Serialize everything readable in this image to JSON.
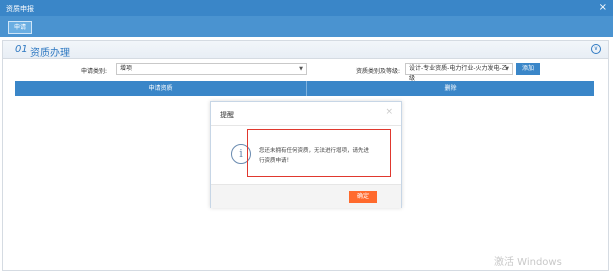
{
  "window": {
    "title": "资质申报",
    "close_glyph": "×"
  },
  "toolbar": {
    "apply_label": "申请"
  },
  "section": {
    "number": "01",
    "title": "资质办理",
    "collapse_icon": "chevron-down-icon"
  },
  "form": {
    "apply_type_label": "申请类别:",
    "apply_type_value": "增项",
    "qualification_label": "资质类别及等级:",
    "qualification_value": "设计-专业资质-电力行业-火力发电-乙级",
    "add_label": "添加"
  },
  "table": {
    "headers": [
      "申请资质",
      "删除"
    ]
  },
  "dialog": {
    "title": "提醒",
    "close_glyph": "×",
    "message_line1": "您还未拥有任何资质，无法进行增项，请先进",
    "message_line2": "行资质申请！",
    "ok_label": "确定",
    "icon": "info-icon"
  },
  "watermark": "激活 Windows",
  "colors": {
    "primary": "#3a86c8",
    "ok": "#ff6a2d",
    "highlight": "#e0382e"
  }
}
